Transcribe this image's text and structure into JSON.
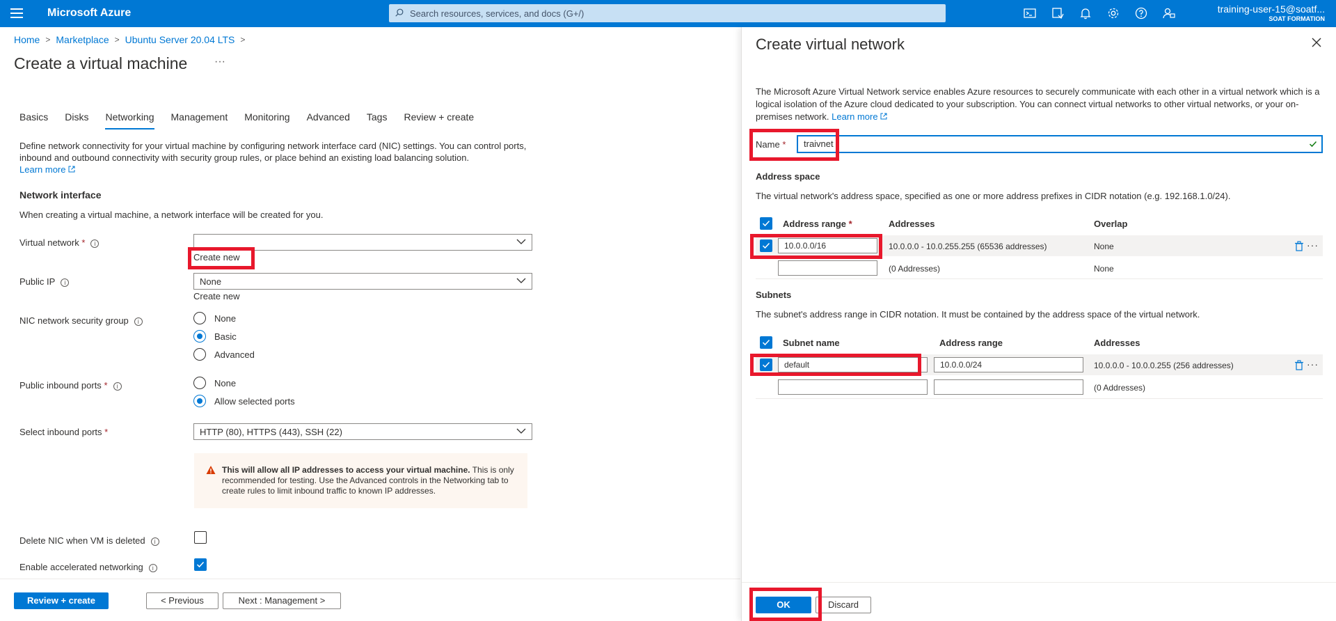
{
  "topbar": {
    "brand": "Microsoft Azure",
    "search_placeholder": "Search resources, services, and docs (G+/)",
    "user": "training-user-15@soatf...",
    "org": "SOAT FORMATION",
    "icons": [
      "cloud-shell-icon",
      "directory-filter-icon",
      "bell-icon",
      "gear-icon",
      "help-icon",
      "feedback-icon"
    ]
  },
  "breadcrumb": [
    "Home",
    "Marketplace",
    "Ubuntu Server 20.04 LTS"
  ],
  "page": {
    "title": "Create a virtual machine",
    "more": "···"
  },
  "tabs": [
    "Basics",
    "Disks",
    "Networking",
    "Management",
    "Monitoring",
    "Advanced",
    "Tags",
    "Review + create"
  ],
  "active_tab": "Networking",
  "networking": {
    "description": "Define network connectivity for your virtual machine by configuring network interface card (NIC) settings. You can control ports, inbound and outbound connectivity with security group rules, or place behind an existing load balancing solution.",
    "learn_more": "Learn more",
    "network_interface_heading": "Network interface",
    "network_interface_text": "When creating a virtual machine, a network interface will be created for you.",
    "virtual_network_label": "Virtual network",
    "virtual_network_value": "",
    "create_new_vnet": "Create new",
    "public_ip_label": "Public IP",
    "public_ip_value": "None",
    "create_new_ip": "Create new",
    "nsg_label": "NIC network security group",
    "nsg_options": [
      "None",
      "Basic",
      "Advanced"
    ],
    "nsg_selected": "Basic",
    "inbound_label": "Public inbound ports",
    "inbound_options": [
      "None",
      "Allow selected ports"
    ],
    "inbound_selected": "Allow selected ports",
    "select_ports_label": "Select inbound ports",
    "select_ports_value": "HTTP (80), HTTPS (443), SSH (22)",
    "warning_bold": "This will allow all IP addresses to access your virtual machine.",
    "warning_rest": "This is only recommended for testing.  Use the Advanced controls in the Networking tab to create rules to limit inbound traffic to known IP addresses.",
    "delete_nic_label": "Delete NIC when VM is deleted",
    "delete_nic_checked": false,
    "accel_label": "Enable accelerated networking",
    "accel_checked": true
  },
  "footer": {
    "review_create": "Review + create",
    "previous": "< Previous",
    "next": "Next : Management >"
  },
  "panel": {
    "title": "Create virtual network",
    "description": "The Microsoft Azure Virtual Network service enables Azure resources to securely communicate with each other in a virtual network which is a logical isolation of the Azure cloud dedicated to your subscription. You can connect virtual networks to other virtual networks, or your on-premises network.",
    "learn_more": "Learn more",
    "name_label": "Name",
    "name_value": "traivnet",
    "address_space_heading": "Address space",
    "address_space_text": "The virtual network's address space, specified as one or more address prefixes in CIDR notation (e.g. 192.168.1.0/24).",
    "address_headers": [
      "Address range",
      "Addresses",
      "Overlap"
    ],
    "address_rows": [
      {
        "range": "10.0.0.0/16",
        "addresses": "10.0.0.0 - 10.0.255.255 (65536 addresses)",
        "overlap": "None"
      },
      {
        "range": "",
        "addresses": "(0 Addresses)",
        "overlap": "None"
      }
    ],
    "subnets_heading": "Subnets",
    "subnets_text": "The subnet's address range in CIDR notation. It must be contained by the address space of the virtual network.",
    "subnet_headers": [
      "Subnet name",
      "Address range",
      "Addresses"
    ],
    "subnet_rows": [
      {
        "name": "default",
        "range": "10.0.0.0/24",
        "addresses": "10.0.0.0 - 10.0.0.255 (256 addresses)"
      },
      {
        "name": "",
        "range": "",
        "addresses": "(0 Addresses)"
      }
    ],
    "ok": "OK",
    "discard": "Discard"
  },
  "colors": {
    "azure_blue": "#0078d4",
    "highlight_red": "#e8182c",
    "warning_bg": "#fdf6f0"
  }
}
